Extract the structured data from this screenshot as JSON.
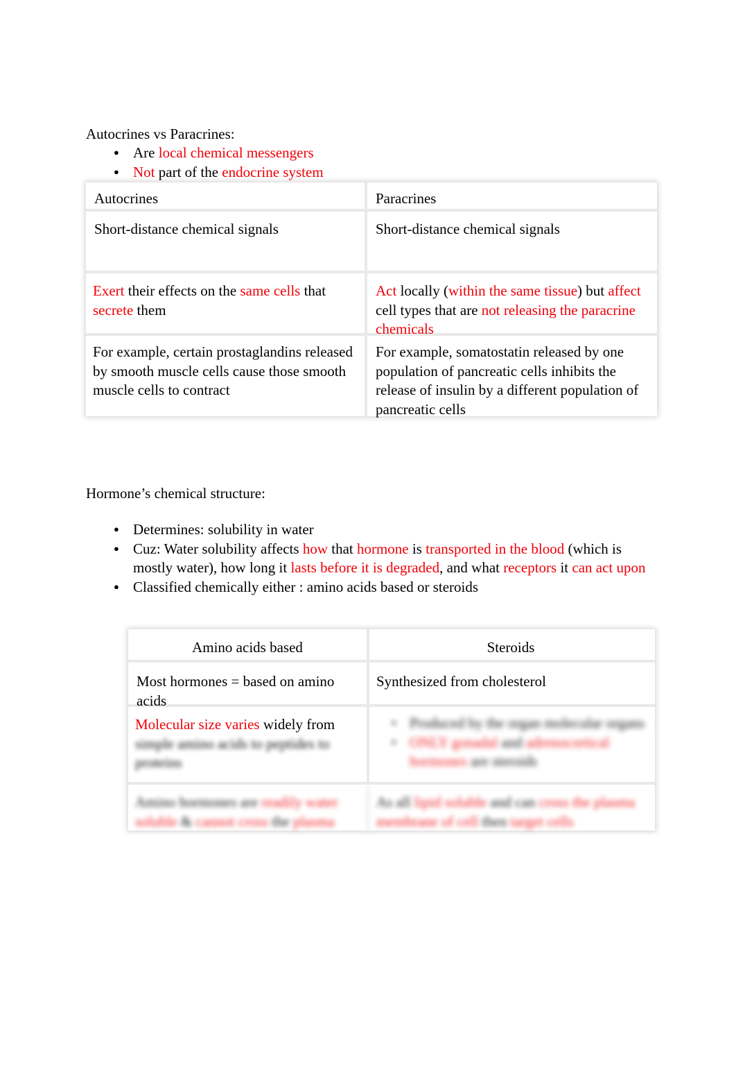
{
  "document": {
    "section1": {
      "heading": "Autocrines vs Paracrines:",
      "bullets": [
        {
          "segments": [
            {
              "text": "Are ",
              "color": "black"
            },
            {
              "text": "local chemical messengers",
              "color": "red"
            }
          ]
        },
        {
          "segments": [
            {
              "text": "Not",
              "color": "red"
            },
            {
              "text": " part of the ",
              "color": "black"
            },
            {
              "text": "endocrine system",
              "color": "red"
            }
          ]
        }
      ],
      "table": {
        "headers": [
          "Autocrines",
          "Paracrines"
        ],
        "rows": [
          {
            "autocrines": [
              {
                "text": " Short-distance chemical signals",
                "color": "black"
              }
            ],
            "paracrines": [
              {
                "text": " Short-distance chemical signals",
                "color": "black"
              }
            ]
          },
          {
            "autocrines": [
              {
                "text": "Exert",
                "color": "red"
              },
              {
                "text": " their effects on the ",
                "color": "black"
              },
              {
                "text": "same cells",
                "color": "red"
              },
              {
                "text": " that ",
                "color": "black"
              },
              {
                "text": "secrete",
                "color": "red"
              },
              {
                "text": " them",
                "color": "black"
              }
            ],
            "paracrines": [
              {
                "text": "Act",
                "color": "red"
              },
              {
                "text": " locally (",
                "color": "black"
              },
              {
                "text": "within the same tissue",
                "color": "red"
              },
              {
                "text": ") but ",
                "color": "black"
              },
              {
                "text": "affect",
                "color": "red"
              },
              {
                "text": " cell types that are ",
                "color": "black"
              },
              {
                "text": "not releasing the paracrine chemicals",
                "color": "red"
              }
            ]
          },
          {
            "autocrines": [
              {
                "text": " For example, certain prostaglandins released by smooth muscle cells cause those smooth muscle cells to contract",
                "color": "black"
              }
            ],
            "paracrines": [
              {
                "text": " For example, somatostatin released by one population of pancreatic cells inhibits the release of insulin by a different population of pancreatic cells",
                "color": "black"
              }
            ]
          }
        ]
      }
    },
    "section2": {
      "heading": "Hormone’s chemical structure:",
      "bullets": [
        {
          "segments": [
            {
              "text": "Determines: solubility in water",
              "color": "black"
            }
          ]
        },
        {
          "segments": [
            {
              "text": "Cuz: Water solubility affects ",
              "color": "black"
            },
            {
              "text": "how",
              "color": "red"
            },
            {
              "text": " that ",
              "color": "black"
            },
            {
              "text": "hormone",
              "color": "red"
            },
            {
              "text": " is ",
              "color": "black"
            },
            {
              "text": "transported in the blood",
              "color": "red"
            },
            {
              "text": " (which is mostly water), how long it ",
              "color": "black"
            },
            {
              "text": "lasts before it is degraded",
              "color": "red"
            },
            {
              "text": ", and what ",
              "color": "black"
            },
            {
              "text": "receptors",
              "color": "red"
            },
            {
              "text": " it ",
              "color": "black"
            },
            {
              "text": "can act upon",
              "color": "red"
            }
          ]
        },
        {
          "segments": [
            {
              "text": "Classified chemically either : amino acids based or steroids",
              "color": "black"
            }
          ]
        }
      ],
      "table": {
        "headers": [
          "Amino acids based",
          "Steroids"
        ],
        "rows": [
          {
            "amino": [
              {
                "text": " Most hormones = based on amino acids",
                "color": "black"
              }
            ],
            "steroids": [
              {
                "text": "Synthesized from cholesterol",
                "color": "black"
              }
            ],
            "blur": "none"
          },
          {
            "amino_visible": [
              {
                "text": "Molecular size varies",
                "color": "red"
              },
              {
                "text": " widely from",
                "color": "black"
              }
            ],
            "amino_obscured": [
              {
                "text": "simple amino acids to peptides to",
                "color": "black"
              },
              {
                "text": "proteins",
                "color": "black"
              }
            ],
            "steroids_obscured_bullets": [
              [
                {
                  "text": "Produced by the organ molecular organs",
                  "color": "black"
                }
              ],
              [
                {
                  "text": "ONLY gonadal",
                  "color": "red"
                },
                {
                  "text": " and ",
                  "color": "black"
                },
                {
                  "text": "adrenocortical hormones",
                  "color": "red"
                },
                {
                  "text": " are steroids",
                  "color": "black"
                }
              ]
            ],
            "blur": "partial"
          },
          {
            "amino": [
              {
                "text": "Amino hormones are ",
                "color": "black"
              },
              {
                "text": "readily water soluble",
                "color": "red"
              },
              {
                "text": " & ",
                "color": "black"
              },
              {
                "text": "cannot cross",
                "color": "red"
              },
              {
                "text": " the ",
                "color": "black"
              },
              {
                "text": "plasma",
                "color": "red"
              }
            ],
            "steroids": [
              {
                "text": "As all ",
                "color": "black"
              },
              {
                "text": "lipid soluble",
                "color": "red"
              },
              {
                "text": " and can ",
                "color": "black"
              },
              {
                "text": "cross",
                "color": "red"
              },
              {
                "text": " the plasma membrane of cell ",
                "color": "red"
              },
              {
                "text": "then ",
                "color": "black"
              },
              {
                "text": "target",
                "color": "red"
              },
              {
                "text": " cells",
                "color": "red"
              }
            ],
            "blur": "full"
          }
        ]
      }
    }
  },
  "colors": {
    "accent_red": "#ee0008",
    "text_black": "#000000",
    "table_divider": "#e9e9e9",
    "page_background": "#ffffff"
  }
}
